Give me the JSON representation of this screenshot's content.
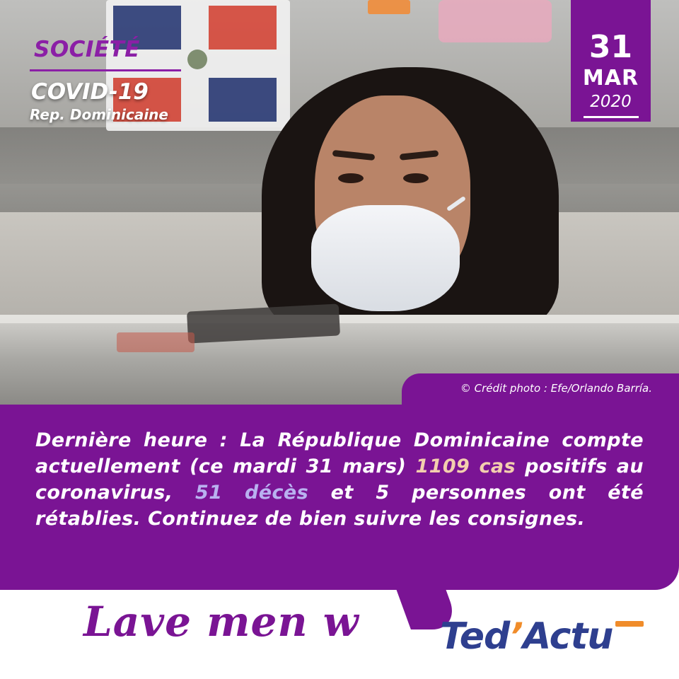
{
  "post": {
    "category": "SOCIÉTÉ",
    "headline": "COVID-19",
    "subheadline": "Rep. Dominicaine",
    "date": {
      "day": "31",
      "month": "MAR",
      "year": "2020"
    },
    "photo_credit": "© Crédit photo : Efe/Orlando Barría.",
    "body": {
      "part1": "Dernière heure : La République Dominicaine compte actuellement (ce mardi 31 mars) ",
      "cases": "1109 cas",
      "part2": " positifs au coronavirus, ",
      "deaths": "51 décès",
      "part3": " et 5 personnes ont été rétablies. Continuez de bien suivre les consignes."
    },
    "slogan": "Lave men w",
    "logo": {
      "main": "Ted",
      "apostrophe": "’",
      "rest": "Actu"
    }
  },
  "colors": {
    "brand_purple": "#7a1494",
    "category_purple": "#8b1fa6",
    "logo_blue": "#2e3f8f",
    "logo_orange": "#f08c2a",
    "cases_highlight": "#f3cfae",
    "deaths_highlight": "#b9b1f0"
  }
}
